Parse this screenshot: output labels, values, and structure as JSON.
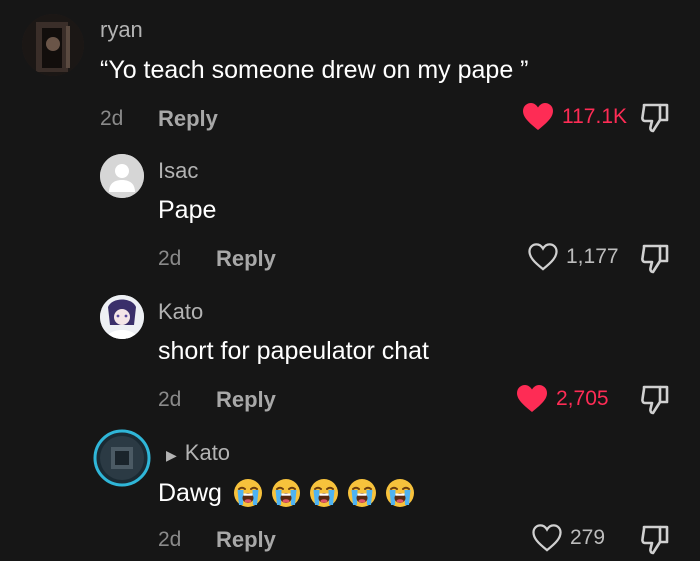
{
  "comments": [
    {
      "user": "ryan",
      "text": "“Yo teach someone drew on my pape ”",
      "time": "2d",
      "reply": "Reply",
      "likes": "117.1K",
      "liked": true
    },
    {
      "user": "Isac",
      "text": "Pape",
      "time": "2d",
      "reply": "Reply",
      "likes": "1,177",
      "liked": false
    },
    {
      "user": "Kato",
      "text": "short for papeulator chat",
      "time": "2d",
      "reply": "Reply",
      "likes": "2,705",
      "liked": true
    },
    {
      "reply_to": "Kato",
      "text": "Dawg",
      "emoji_count": 5,
      "emoji_name": "loudly-crying-face",
      "time": "2d",
      "reply": "Reply",
      "likes": "279",
      "liked": false
    }
  ],
  "colors": {
    "background": "#161616",
    "like_accent": "#fe2c55",
    "muted": "#8a8a8a"
  }
}
